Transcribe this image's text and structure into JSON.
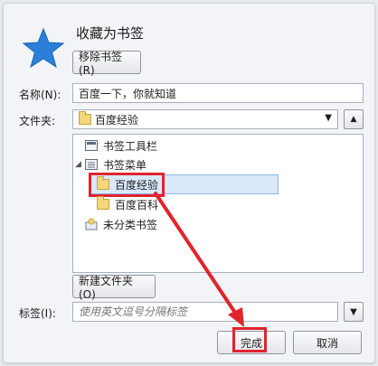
{
  "dialog": {
    "title": "收藏为书签",
    "remove_button": "移除书签(R)"
  },
  "fields": {
    "name_label": "名称(N):",
    "name_value": "百度一下，你就知道",
    "folder_label": "文件夹:",
    "folder_value": "百度经验",
    "tags_label": "标签(I):",
    "tags_placeholder": "使用英文逗号分隔标签"
  },
  "tree": {
    "items": [
      {
        "label": "书签工具栏",
        "icon": "toolbar-icon"
      },
      {
        "label": "书签菜单",
        "icon": "menu-icon"
      },
      {
        "label": "百度经验",
        "icon": "folder-icon"
      },
      {
        "label": "百度百科",
        "icon": "folder-icon"
      },
      {
        "label": "未分类书签",
        "icon": "unsorted-icon"
      }
    ]
  },
  "buttons": {
    "new_folder": "新建文件夹(O)",
    "done": "完成",
    "cancel": "取消"
  },
  "colors": {
    "star": "#2b7fd8",
    "highlight": "#e0242c",
    "selection": "#d9e9fb"
  }
}
